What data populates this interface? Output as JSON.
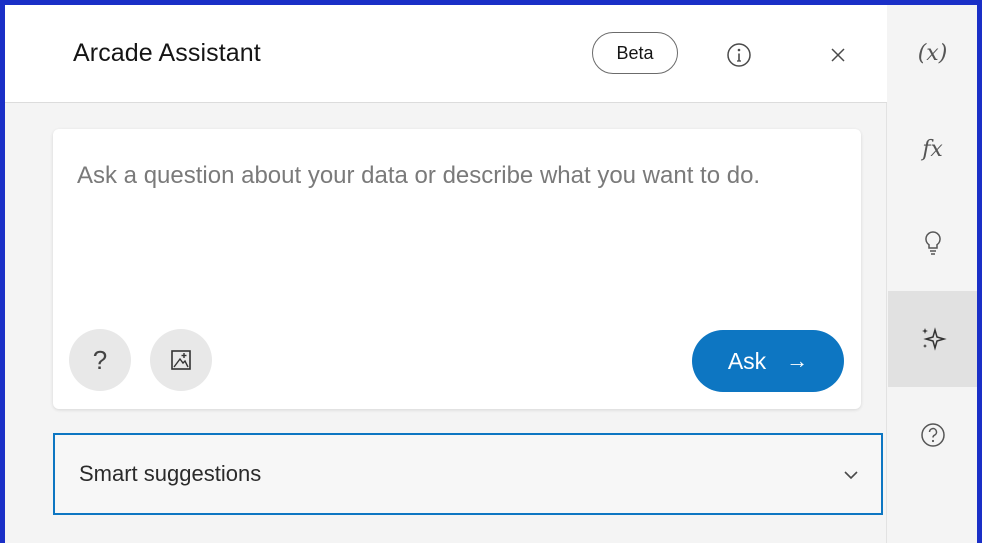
{
  "header": {
    "title": "Arcade Assistant",
    "badge": "Beta",
    "info_icon": "info-icon",
    "close_icon": "close-icon"
  },
  "prompt": {
    "value": "",
    "placeholder": "Ask a question about your data or describe what you want to do."
  },
  "actions": {
    "help_label": "?",
    "image_icon": "image-crop-icon",
    "ask_label": "Ask",
    "ask_arrow": "→"
  },
  "suggestions": {
    "label": "Smart suggestions",
    "chevron_icon": "chevron-down-icon"
  },
  "rail": {
    "items": [
      {
        "label": "(x)",
        "icon": "variables-icon",
        "active": false
      },
      {
        "label": "fx",
        "icon": "functions-icon",
        "active": false
      },
      {
        "label": "",
        "icon": "lightbulb-icon",
        "active": false
      },
      {
        "label": "",
        "icon": "sparkles-icon",
        "active": true
      },
      {
        "label": "",
        "icon": "help-circle-icon",
        "active": false
      }
    ]
  },
  "colors": {
    "accent": "#0d76c2",
    "background": "#1a2fc7",
    "panel": "#f4f4f4"
  }
}
